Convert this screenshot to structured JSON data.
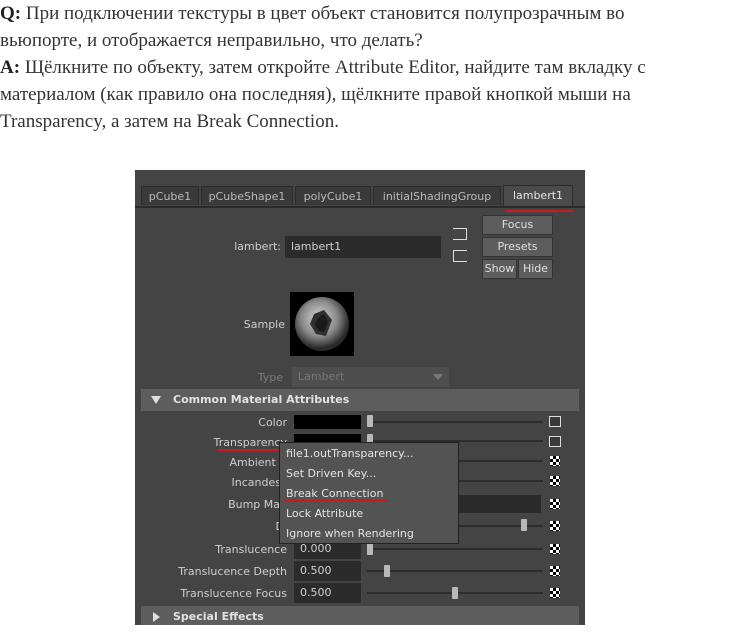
{
  "qa": {
    "q_prefix": "Q:",
    "q_line1": " При подключении текстуры в цвет объект становится полупрозрачным во",
    "q_line2": "вьюпорте, и отображается неправильно, что делать?",
    "a_prefix": "A:",
    "a_line1": " Щёлкните по объекту, затем откройте Attribute Editor, найдите там вкладку с",
    "a_line2": "материалом (как правило она последняя), щёлкните правой кнопкой мыши на",
    "a_line3": "Transparency, а затем на Break Connection."
  },
  "editor": {
    "tabs": [
      "pCube1",
      "pCubeShape1",
      "polyCube1",
      "initialShadingGroup",
      "lambert1"
    ],
    "active_tab": "lambert1",
    "node_label": "lambert:",
    "node_value": "lambert1",
    "buttons": {
      "focus": "Focus",
      "presets": "Presets",
      "show": "Show",
      "hide": "Hide"
    },
    "sample_label": "Sample",
    "type_label": "Type",
    "type_value": "Lambert",
    "section_common": "Common Material Attributes",
    "section_special": "Special Effects",
    "attrs": {
      "color": "Color",
      "transparency": "Transparency",
      "ambient": "Ambient C",
      "incandescence": "Incandesc",
      "bump": "Bump Map",
      "diffuse": "Di",
      "translucence": "Translucence",
      "translucence_depth": "Translucence Depth",
      "translucence_focus": "Translucence Focus"
    },
    "values": {
      "translucence": "0.000",
      "translucence_depth": "0.500",
      "translucence_focus": "0.500"
    },
    "slider_levels": {
      "diffuse": 0.8,
      "translucence": 0.0,
      "translucence_depth": 0.1,
      "translucence_focus": 0.5
    },
    "context_menu": [
      "file1.outTransparency...",
      "Set Driven Key...",
      "Break Connection",
      "Lock Attribute",
      "Ignore when Rendering"
    ],
    "highlight_color": "#cc1a1a"
  }
}
